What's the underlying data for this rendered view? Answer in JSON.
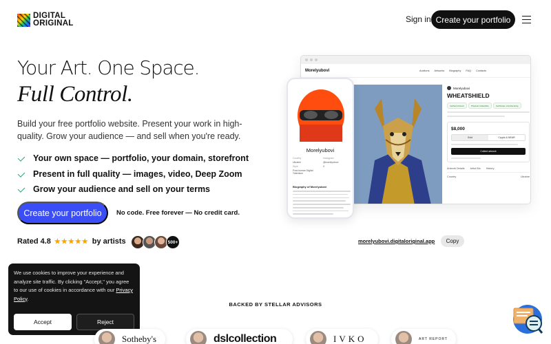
{
  "header": {
    "logo_line1": "DIGITAL",
    "logo_line2": "ORIGINAL",
    "signin": "Sign in",
    "create_portfolio": "Create your portfolio"
  },
  "hero": {
    "title_line1": "Your Art. One Space.",
    "title_line2": "Full Control.",
    "subtitle": "Build your free portfolio website. Present your work in high-quality. Grow your audience — and sell when you're ready.",
    "features": [
      "Your own space — portfolio, your domain, storefront",
      "Present in full quality — images, video, Deep Zoom",
      "Grow your audience and sell on your terms"
    ],
    "cta": "Create your portfolio",
    "cta_note": "No code. Free forever — No credit card.",
    "rated_prefix": "Rated 4.8",
    "stars": "★★★★★",
    "rated_suffix": "by artists",
    "artists_count": "500+"
  },
  "mockup": {
    "site_name": "Morelyubovi",
    "nav_links": [
      "Auctions",
      "Artworks",
      "Biography",
      "FAQ",
      "Contacts"
    ],
    "artist_name": "Morelyubovi",
    "artwork_title": "WHEATSHIELD",
    "chips": [
      "Verified Artwork",
      "Physical Collectible",
      "Certificate of Authenticity"
    ],
    "price": "$8,000",
    "tab_sold": "Sold",
    "tab_crypto": "Crypto & NEAR",
    "collect_label": "Collect artwork",
    "bottom_tabs": [
      "Artwork Details",
      "Artist Bio",
      "History"
    ],
    "country_label": "Country",
    "country_value": "Ukraine",
    "phone_name": "Morelyubovi",
    "phone_fields": [
      {
        "k": "Country",
        "v": "Ukraine"
      },
      {
        "k": "Instagram",
        "v": "@morelyubovi"
      },
      {
        "k": "Style",
        "v": "X"
      },
      {
        "k": "Post-human Digital Totemism",
        "v": ""
      }
    ],
    "phone_bio_title": "Biography of Morelyubovi"
  },
  "url_bar": {
    "url": "morelyubovi.digitaloriginal.app",
    "copy_label": "Copy"
  },
  "cookie": {
    "text_before": "We use cookies to improve your experience and analyze site traffic. By clicking \"Accept,\" you agree to our use of cookies in accordance with our ",
    "link": "Privacy Policy",
    "text_after": ".",
    "accept": "Accept",
    "reject": "Reject"
  },
  "backed": {
    "label": "BACKED BY STELLAR ADVISORS",
    "partners": [
      "Sotheby's",
      "dslcollection",
      "IVKO",
      "ART REPORT"
    ]
  },
  "colors": {
    "primary": "#3b4ef5",
    "dark": "#111111",
    "check": "#21a366",
    "star": "#f5a400",
    "chat": "#2a6fdb"
  }
}
